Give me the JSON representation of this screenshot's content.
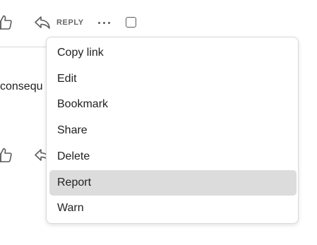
{
  "comment": {
    "text_fragment": "consequ",
    "actions": {
      "reply_label": "REPLY"
    }
  },
  "menu": {
    "items": [
      {
        "label": "Copy link",
        "highlighted": false
      },
      {
        "label": "Edit",
        "highlighted": false
      },
      {
        "label": "Bookmark",
        "highlighted": false
      },
      {
        "label": "Share",
        "highlighted": false
      },
      {
        "label": "Delete",
        "highlighted": false
      },
      {
        "label": "Report",
        "highlighted": true
      },
      {
        "label": "Warn",
        "highlighted": false
      }
    ],
    "highlight_color": "#dcdcdc"
  },
  "icons": {
    "like": "thumbs-up-icon",
    "reply": "reply-arrow-icon",
    "more": "ellipsis-icon"
  },
  "colors": {
    "icon": "#5b5b5b",
    "text": "#1f1f1f",
    "reply_label": "#666666"
  }
}
